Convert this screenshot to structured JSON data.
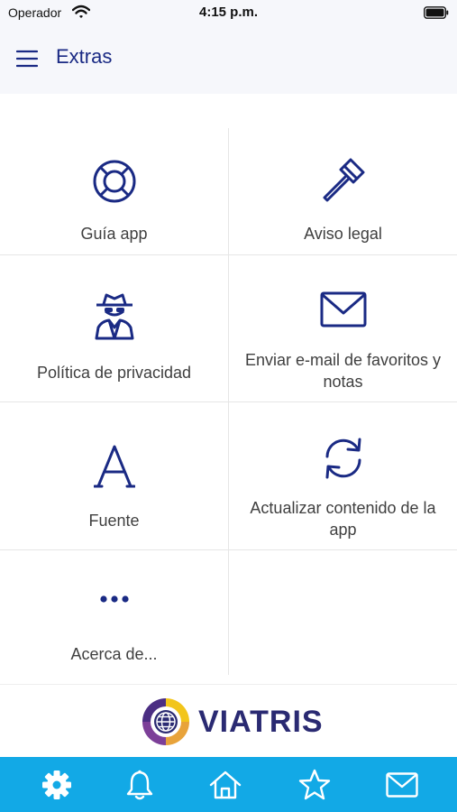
{
  "status_bar": {
    "carrier": "Operador",
    "time": "4:15 p.m.",
    "icons": [
      "wifi-icon",
      "battery-icon"
    ]
  },
  "header": {
    "title": "Extras",
    "menu_icon": "menu-icon"
  },
  "grid": {
    "items": [
      {
        "label": "Guía app",
        "icon": "lifebuoy-icon"
      },
      {
        "label": "Aviso legal",
        "icon": "gavel-icon"
      },
      {
        "label": "Política de privacidad",
        "icon": "spy-icon"
      },
      {
        "label": "Enviar e-mail de favoritos y notas",
        "icon": "envelope-icon"
      },
      {
        "label": "Fuente",
        "icon": "font-icon"
      },
      {
        "label": "Actualizar contenido de la app",
        "icon": "refresh-icon"
      },
      {
        "label": "Acerca de...",
        "icon": "more-icon"
      }
    ]
  },
  "logo": {
    "text": "VIATRIS",
    "icon": "viatris-logo-mark"
  },
  "tab_bar": {
    "tabs": [
      {
        "icon": "gear-icon",
        "active": true
      },
      {
        "icon": "bell-icon",
        "active": false
      },
      {
        "icon": "home-icon",
        "active": false
      },
      {
        "icon": "star-icon",
        "active": false
      },
      {
        "icon": "mail-icon",
        "active": false
      }
    ]
  },
  "colors": {
    "accent": "#1a2a84",
    "tab_bar": "#12a9e6",
    "header_bg": "#f6f7fb",
    "label": "#3f3f3f",
    "divider": "#e6e6e6"
  }
}
